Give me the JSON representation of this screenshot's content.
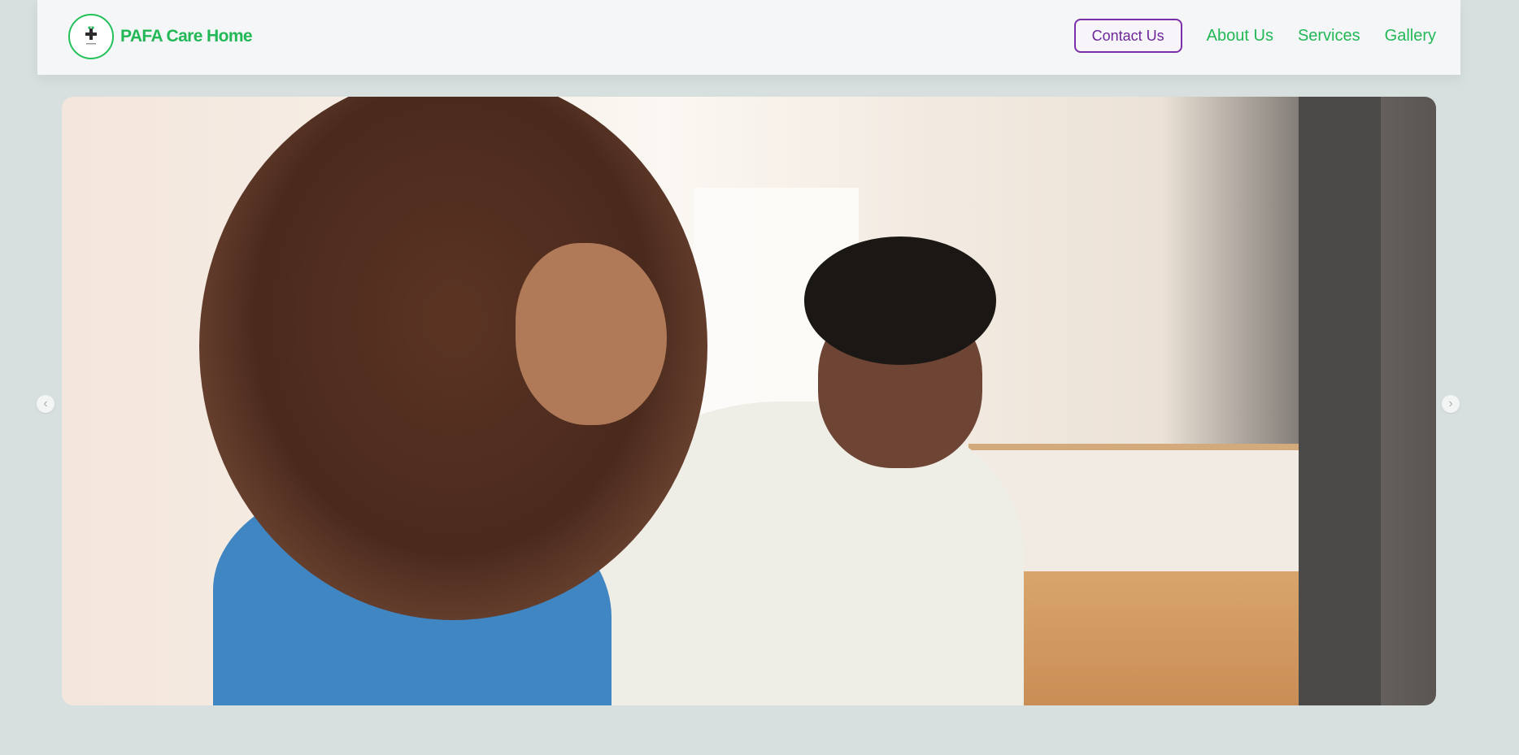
{
  "brand": {
    "name": "PAFA Care Home",
    "logo_icon": "medical-cross-icon"
  },
  "nav": {
    "contact_label": "Contact Us",
    "links": [
      {
        "label": "About Us"
      },
      {
        "label": "Services"
      },
      {
        "label": "Gallery"
      }
    ]
  },
  "carousel": {
    "prev_icon": "chevron-left-icon",
    "next_icon": "chevron-right-icon",
    "prev_glyph": "‹",
    "next_glyph": "›",
    "slide_image": "nurse-assisting-elderly-woman-photo"
  },
  "colors": {
    "brand_green": "#22b856",
    "contact_purple": "#7a2fa8",
    "page_bg": "#d7dfdf",
    "navbar_bg": "#f4f6f7"
  }
}
